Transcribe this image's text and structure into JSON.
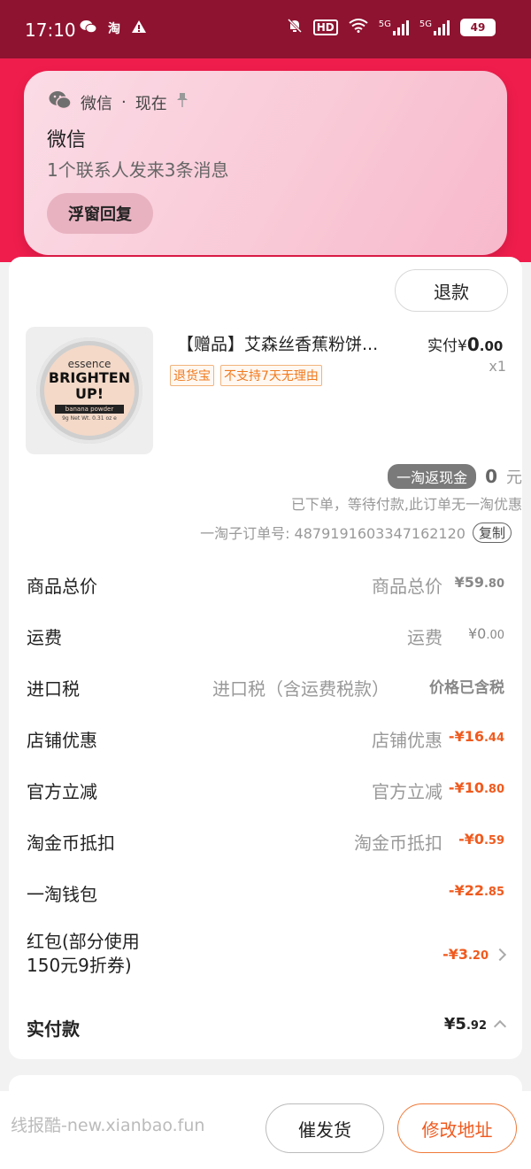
{
  "status_bar": {
    "time": "17:10",
    "icons_left": [
      "wechat-icon",
      "taobao-icon",
      "warning-icon"
    ],
    "icons_right": [
      "mute-icon",
      "hd-icon",
      "wifi-icon",
      "signal-5g-icon",
      "signal-5g-icon",
      "battery-icon"
    ],
    "hd_label": "HD",
    "net1": "5G",
    "net2": "5G",
    "battery_level": "49"
  },
  "notification": {
    "app": "微信",
    "when": "现在",
    "separator": "·",
    "title": "微信",
    "message": "1个联系人发来3条消息",
    "reply_button": "浮窗回复"
  },
  "order": {
    "refund_button": "退款",
    "product": {
      "title": "【赠品】艾森丝香蕉粉饼...",
      "price_prefix": "实付",
      "price_currency": "¥",
      "price_int": "0",
      "price_dec": ".00",
      "quantity": "x1",
      "tags": [
        "退货宝",
        "不支持7天无理由"
      ],
      "image": {
        "brand": "essence",
        "line1": "BRIGHTEN",
        "line2": "UP!",
        "strip": "banana powder",
        "net": "9g Net Wt. 0.31 oz e"
      }
    },
    "cashback": {
      "label": "一淘返现金",
      "amount": "0",
      "unit": "元"
    },
    "status_text": "已下单，等待付款,此订单无一淘优惠",
    "suborder": {
      "label": "一淘子订单号: 4879191603347162120",
      "copy": "复制"
    },
    "fees": [
      {
        "label": "商品总价",
        "rlabel": "商品总价",
        "amt_main": "¥59",
        "amt_dec": ".80",
        "style": "gray"
      },
      {
        "label": "运费",
        "rlabel": "运费",
        "amt_main": "¥0",
        "amt_dec": ".00",
        "style": "gray"
      },
      {
        "label": "进口税",
        "rlabel": "进口税（含运费税款）",
        "amt_main": "价格已含税",
        "amt_dec": "",
        "style": "gray-bold"
      },
      {
        "label": "店铺优惠",
        "rlabel": "店铺优惠",
        "amt_main": "-¥16",
        "amt_dec": ".44",
        "style": "orange"
      },
      {
        "label": "官方立减",
        "rlabel": "官方立减",
        "amt_main": "-¥10",
        "amt_dec": ".80",
        "style": "orange"
      },
      {
        "label": "淘金币抵扣",
        "rlabel": "淘金币抵扣",
        "amt_main": "-¥0",
        "amt_dec": ".59",
        "style": "orange"
      },
      {
        "label": "一淘钱包",
        "rlabel": "",
        "amt_main": "-¥22",
        "amt_dec": ".85",
        "style": "orange"
      }
    ],
    "red_packet": {
      "line1": "红包(部分使用",
      "line2": "150元9折券)",
      "amt_main": "-¥3",
      "amt_dec": ".20"
    },
    "total": {
      "label": "实付款",
      "amt_main": "¥5",
      "amt_dec": ".92"
    }
  },
  "bottom": {
    "watermark": "线报酷-new.xianbao.fun",
    "urge_button": "催发货",
    "address_button": "修改地址"
  },
  "colors": {
    "status_bar": "#8e1330",
    "header": "#ef1d4c",
    "accent_orange": "#f05a1e"
  }
}
